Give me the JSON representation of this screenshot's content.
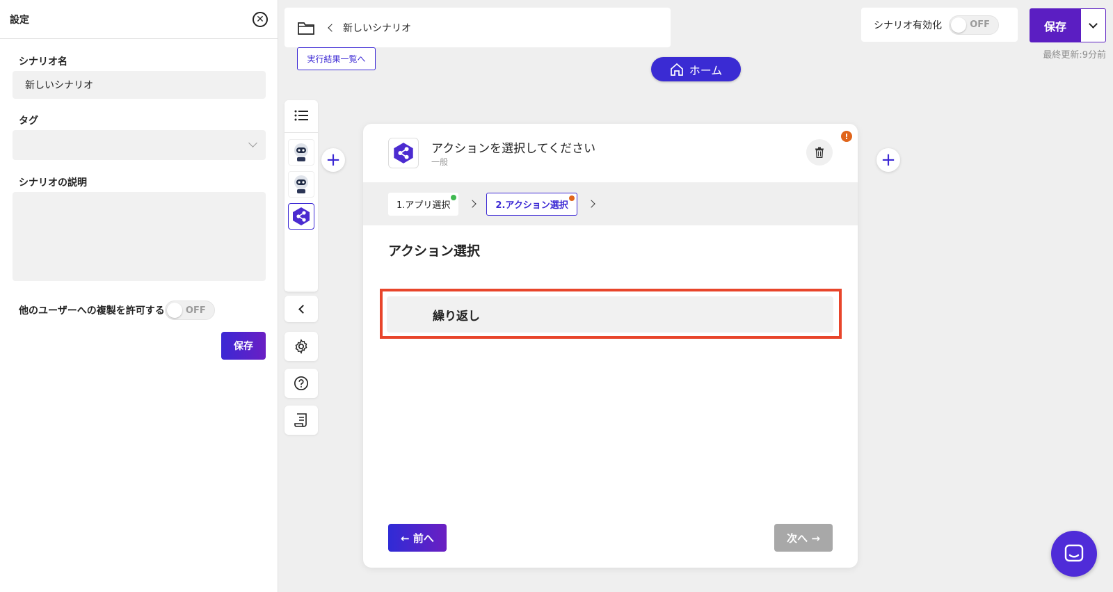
{
  "settings": {
    "title": "設定",
    "name_label": "シナリオ名",
    "name_value": "新しいシナリオ",
    "tag_label": "タグ",
    "desc_label": "シナリオの説明",
    "copy_label": "他のユーザーへの複製を許可する",
    "copy_toggle": "OFF",
    "save_label": "保存"
  },
  "topbar": {
    "scenario_name": "新しいシナリオ",
    "results_link": "実行結果一覧へ",
    "home_label": "ホーム",
    "enable_label": "シナリオ有効化",
    "enable_toggle": "OFF",
    "save_label": "保存",
    "last_update": "最終更新:9分前"
  },
  "card": {
    "title": "アクションを選択してください",
    "subtitle": "一般",
    "warning_mark": "!",
    "steps": [
      {
        "label": "1.アプリ選択",
        "status_color": "#3fb950"
      },
      {
        "label": "2.アクション選択",
        "status_color": "#e0651b"
      }
    ],
    "section_title": "アクション選択",
    "action_option": "繰り返し",
    "prev_label": "← 前へ",
    "next_label": "次へ →"
  },
  "colors": {
    "accent": "#3b28d4",
    "highlight": "#e8452b"
  }
}
